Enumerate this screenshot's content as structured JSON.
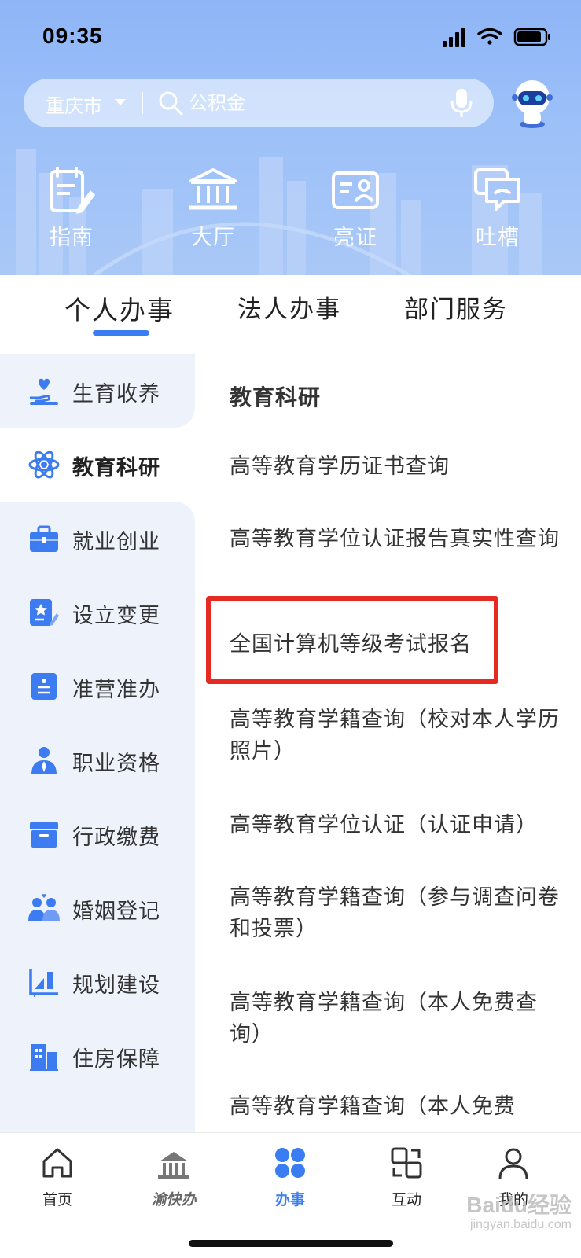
{
  "status_bar": {
    "time": "09:35"
  },
  "search": {
    "city": "重庆市",
    "placeholder": "公积金"
  },
  "quick_actions": [
    {
      "label": "指南",
      "icon": "guide-icon"
    },
    {
      "label": "大厅",
      "icon": "hall-icon"
    },
    {
      "label": "亮证",
      "icon": "id-card-icon"
    },
    {
      "label": "吐槽",
      "icon": "feedback-icon"
    }
  ],
  "tabs": [
    {
      "label": "个人办事",
      "active": true
    },
    {
      "label": "法人办事",
      "active": false
    },
    {
      "label": "部门服务",
      "active": false
    }
  ],
  "sidebar": {
    "items": [
      {
        "label": "生育收养",
        "icon": "hand-heart-icon"
      },
      {
        "label": "教育科研",
        "icon": "atom-icon",
        "active": true
      },
      {
        "label": "就业创业",
        "icon": "briefcase-icon"
      },
      {
        "label": "设立变更",
        "icon": "star-edit-icon"
      },
      {
        "label": "准营准办",
        "icon": "license-icon"
      },
      {
        "label": "职业资格",
        "icon": "person-tie-icon"
      },
      {
        "label": "行政缴费",
        "icon": "box-icon"
      },
      {
        "label": "婚姻登记",
        "icon": "couple-icon"
      },
      {
        "label": "规划建设",
        "icon": "chart-ruler-icon"
      },
      {
        "label": "住房保障",
        "icon": "building-icon"
      }
    ]
  },
  "content": {
    "section_title": "教育科研",
    "items": [
      {
        "label": "高等教育学历证书查询"
      },
      {
        "label": "高等教育学位认证报告真实性查询"
      },
      {
        "label": "全国计算机等级考试报名",
        "highlighted": true
      },
      {
        "label": "高等教育学籍查询（校对本人学历照片）"
      },
      {
        "label": "高等教育学位认证（认证申请）"
      },
      {
        "label": "高等教育学籍查询（参与调查问卷和投票）"
      },
      {
        "label": "高等教育学籍查询（本人免费查询）"
      },
      {
        "label": "高等教育学籍查询（本人免费"
      }
    ]
  },
  "bottom_nav": {
    "items": [
      {
        "label": "首页",
        "icon": "home-icon"
      },
      {
        "label": "渝快办",
        "icon": "yukuaiban-logo-icon"
      },
      {
        "label": "办事",
        "icon": "services-grid-icon",
        "active": true
      },
      {
        "label": "互动",
        "icon": "interaction-icon"
      },
      {
        "label": "我的",
        "icon": "user-icon"
      }
    ]
  },
  "watermark": {
    "brand": "Baidu经验",
    "url": "jingyan.baidu.com"
  },
  "colors": {
    "accent": "#3a7cf2",
    "highlight_border": "#e52a21",
    "sidebar_bg": "#eef2fb",
    "header_blue": "#9cc0f8"
  }
}
